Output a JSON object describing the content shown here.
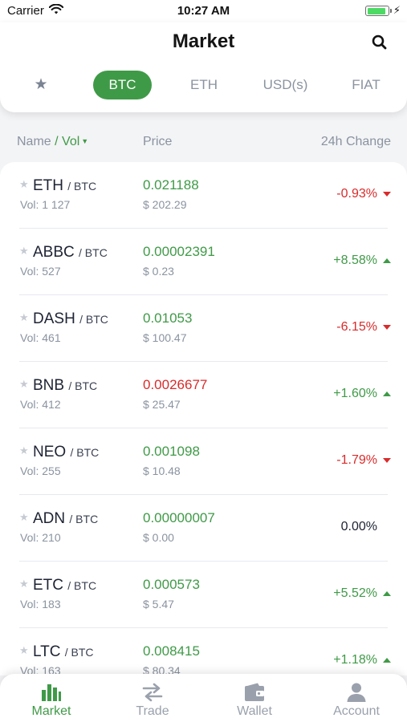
{
  "status_bar": {
    "carrier": "Carrier",
    "time": "10:27 AM"
  },
  "header": {
    "title": "Market"
  },
  "tabs": [
    {
      "label": "★"
    },
    {
      "label": "BTC"
    },
    {
      "label": "ETH"
    },
    {
      "label": "USD(s)"
    },
    {
      "label": "FIAT"
    }
  ],
  "columns": {
    "name": "Name",
    "separator": " / ",
    "vol": "Vol",
    "price": "Price",
    "change": "24h Change"
  },
  "rows": [
    {
      "base": "ETH",
      "quote": "/ BTC",
      "vol": "Vol: 1 127",
      "price": "0.021188",
      "fiat": "$ 202.29",
      "change": "-0.93%"
    },
    {
      "base": "ABBC",
      "quote": "/ BTC",
      "vol": "Vol: 527",
      "price": "0.00002391",
      "fiat": "$ 0.23",
      "change": "+8.58%"
    },
    {
      "base": "DASH",
      "quote": "/ BTC",
      "vol": "Vol: 461",
      "price": "0.01053",
      "fiat": "$ 100.47",
      "change": "-6.15%"
    },
    {
      "base": "BNB",
      "quote": "/ BTC",
      "vol": "Vol: 412",
      "price": "0.0026677",
      "fiat": "$ 25.47",
      "change": "+1.60%"
    },
    {
      "base": "NEO",
      "quote": "/ BTC",
      "vol": "Vol: 255",
      "price": "0.001098",
      "fiat": "$ 10.48",
      "change": "-1.79%"
    },
    {
      "base": "ADN",
      "quote": "/ BTC",
      "vol": "Vol: 210",
      "price": "0.00000007",
      "fiat": "$ 0.00",
      "change": "0.00%"
    },
    {
      "base": "ETC",
      "quote": "/ BTC",
      "vol": "Vol: 183",
      "price": "0.000573",
      "fiat": "$ 5.47",
      "change": "+5.52%"
    },
    {
      "base": "LTC",
      "quote": "/ BTC",
      "vol": "Vol: 163",
      "price": "0.008415",
      "fiat": "$ 80.34",
      "change": "+1.18%"
    }
  ],
  "tabbar": [
    {
      "label": "Market",
      "icon": "bar-chart-icon"
    },
    {
      "label": "Trade",
      "icon": "swap-arrows-icon"
    },
    {
      "label": "Wallet",
      "icon": "wallet-icon"
    },
    {
      "label": "Account",
      "icon": "person-icon"
    }
  ],
  "colors": {
    "accent": "#3f9a47",
    "negative": "#d92b2b",
    "muted": "#8a93a0"
  }
}
